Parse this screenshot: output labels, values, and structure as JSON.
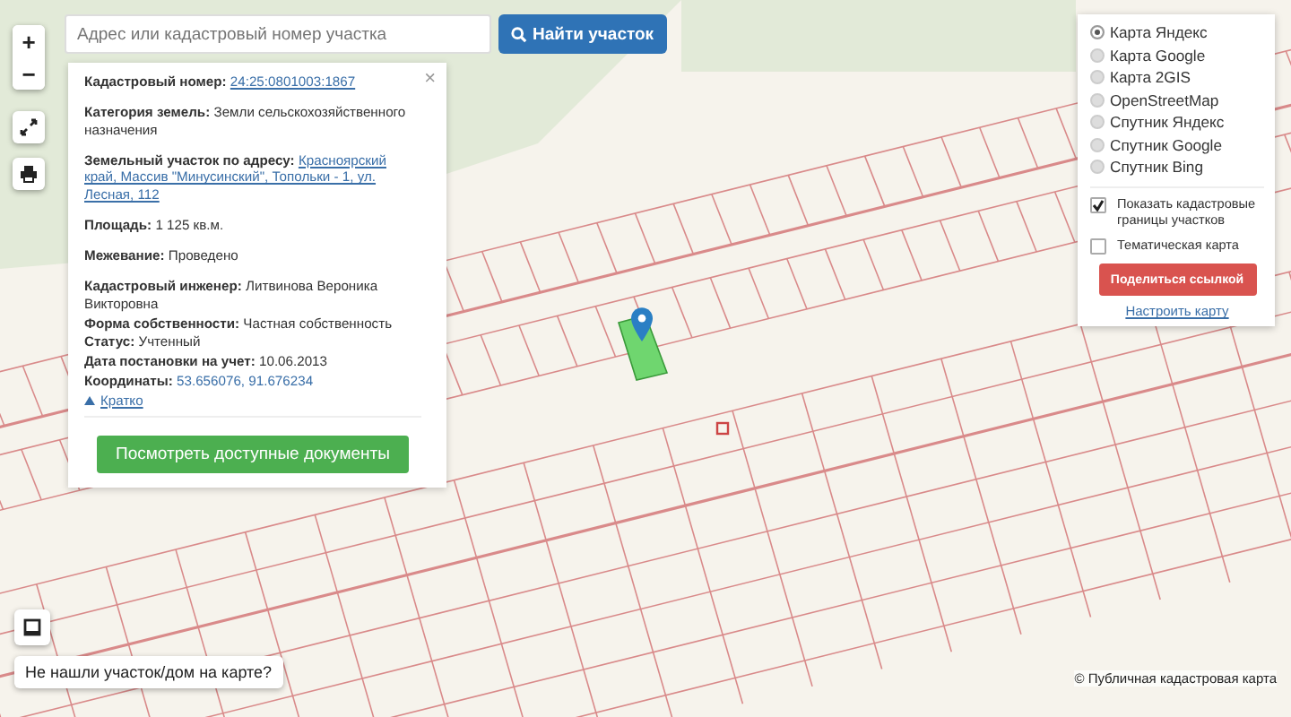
{
  "map_controls": {
    "zoom_in": "+",
    "zoom_out": "−"
  },
  "search": {
    "placeholder": "Адрес или кадастровый номер участка",
    "button": "Найти участок"
  },
  "info_panel": {
    "close": "×",
    "rows": [
      {
        "kind": "link",
        "label": "Кадастровый номер:",
        "value": "24:25:0801003:1867"
      },
      {
        "kind": "text",
        "label": "Категория земель:",
        "value": "Земли сельскохозяйственного назначения"
      },
      {
        "kind": "link",
        "label": "Земельный участок по адресу:",
        "value": "Красноярский край, Массив \"Минусинский\", Топольки - 1, ул. Лесная, 112"
      },
      {
        "kind": "text",
        "label": "Площадь:",
        "value": "1 125 кв.м."
      },
      {
        "kind": "text",
        "label": "Межевание:",
        "value": "Проведено"
      },
      {
        "kind": "compact",
        "label": "Кадастровый инженер:",
        "value": "Литвинова Вероника Викторовна"
      },
      {
        "kind": "compact",
        "label": "Форма собственности:",
        "value": "Частная собственность"
      },
      {
        "kind": "compact",
        "label": "Статус:",
        "value": "Учтенный"
      },
      {
        "kind": "compact",
        "label": "Дата постановки на учет:",
        "value": "10.06.2013"
      },
      {
        "kind": "coords",
        "label": "Координаты:",
        "value": "53.656076, 91.676234"
      }
    ],
    "collapse_link": "Кратко",
    "documents_button": "Посмотреть доступные документы"
  },
  "layers_panel": {
    "base_maps": [
      {
        "label": "Карта Яндекс",
        "selected": true
      },
      {
        "label": "Карта Google",
        "selected": false
      },
      {
        "label": "Карта 2GIS",
        "selected": false
      },
      {
        "label": "OpenStreetMap",
        "selected": false
      },
      {
        "label": "Спутник Яндекс",
        "selected": false
      },
      {
        "label": "Спутник Google",
        "selected": false
      },
      {
        "label": "Спутник Bing",
        "selected": false
      }
    ],
    "overlays": [
      {
        "label": "Показать кадастровые границы участков",
        "checked": true
      },
      {
        "label": "Тематическая карта",
        "checked": false
      }
    ],
    "share_button": "Поделиться ссылкой",
    "settings_link": "Настроить карту"
  },
  "not_found_button": "Не нашли участок/дом на карте?",
  "attribution": "© Публичная кадастровая карта"
}
